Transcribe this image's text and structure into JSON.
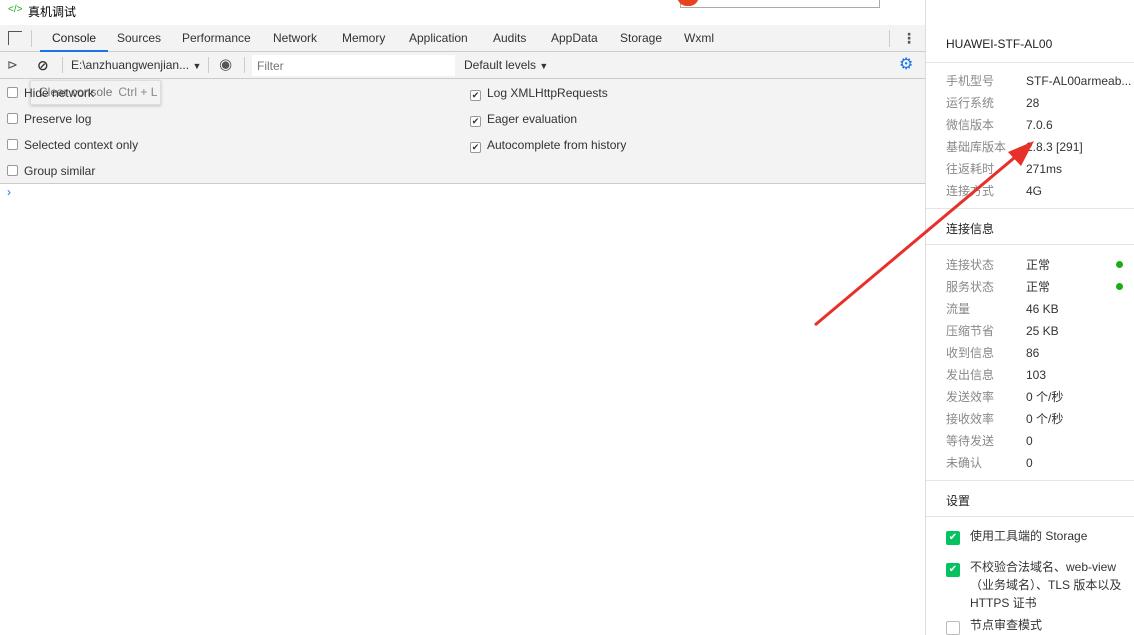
{
  "window": {
    "title": "真机调试"
  },
  "tabs": [
    "Console",
    "Sources",
    "Performance",
    "Network",
    "Memory",
    "Application",
    "Audits",
    "AppData",
    "Storage",
    "Wxml"
  ],
  "toolbar": {
    "context": "E:\\anzhuangwenjian...",
    "filter_placeholder": "Filter",
    "levels": "Default levels"
  },
  "settings": {
    "left": [
      {
        "label": "Hide network",
        "checked": false
      },
      {
        "label": "Preserve log",
        "checked": false
      },
      {
        "label": "Selected context only",
        "checked": false
      },
      {
        "label": "Group similar",
        "checked": false
      }
    ],
    "right": [
      {
        "label": "Log XMLHttpRequests",
        "checked": true
      },
      {
        "label": "Eager evaluation",
        "checked": true
      },
      {
        "label": "Autocomplete from history",
        "checked": true
      }
    ]
  },
  "tooltip": {
    "label": "Clear console",
    "shortcut": "Ctrl + L"
  },
  "console": {
    "prompt": "›"
  },
  "side": {
    "device": "HUAWEI-STF-AL00",
    "info": [
      {
        "k": "手机型号",
        "v": "STF-AL00armeab..."
      },
      {
        "k": "运行系统",
        "v": "28"
      },
      {
        "k": "微信版本",
        "v": "7.0.6"
      },
      {
        "k": "基础库版本",
        "v": "2.8.3 [291]"
      },
      {
        "k": "往返耗时",
        "v": "271ms"
      },
      {
        "k": "连接方式",
        "v": "4G"
      }
    ],
    "conn_title": "连接信息",
    "conn": [
      {
        "k": "连接状态",
        "v": "正常"
      },
      {
        "k": "服务状态",
        "v": "正常"
      },
      {
        "k": "流量",
        "v": "46 KB"
      },
      {
        "k": "压缩节省",
        "v": "25 KB"
      },
      {
        "k": "收到信息",
        "v": "86"
      },
      {
        "k": "发出信息",
        "v": "103"
      },
      {
        "k": "发送效率",
        "v": "0 个/秒"
      },
      {
        "k": "接收效率",
        "v": "0 个/秒"
      },
      {
        "k": "等待发送",
        "v": "0"
      },
      {
        "k": "未确认",
        "v": "0"
      }
    ],
    "settings_title": "设置",
    "options": [
      {
        "label": "使用工具端的 Storage",
        "checked": true
      },
      {
        "label": "不校验合法域名、web-view（业务域名）、TLS 版本以及 HTTPS 证书",
        "checked": true
      },
      {
        "label": "节点审查模式",
        "checked": false
      }
    ]
  },
  "colors": {
    "accent": "#1a73e8",
    "green": "#07c160",
    "arrow": "#e8302a"
  }
}
